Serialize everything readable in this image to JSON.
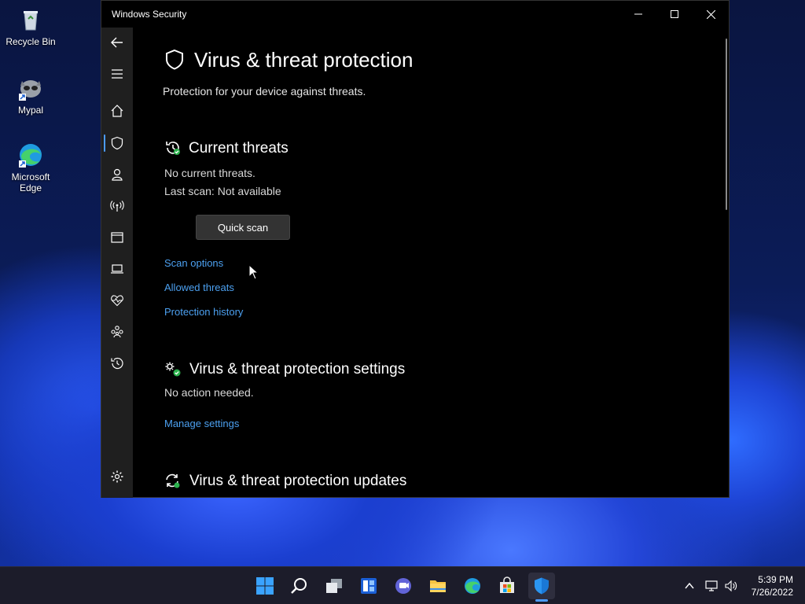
{
  "desktop": {
    "icons": [
      {
        "label": "Recycle Bin"
      },
      {
        "label": "Mypal"
      },
      {
        "label": "Microsoft Edge"
      }
    ]
  },
  "window": {
    "title": "Windows Security",
    "page_title": "Virus & threat protection",
    "page_subtitle": "Protection for your device against threats.",
    "current_threats": {
      "heading": "Current threats",
      "status": "No current threats.",
      "last_scan": "Last scan: Not available",
      "quick_scan_label": "Quick scan",
      "links": [
        "Scan options",
        "Allowed threats",
        "Protection history"
      ]
    },
    "settings": {
      "heading": "Virus & threat protection settings",
      "status": "No action needed.",
      "link": "Manage settings"
    },
    "updates": {
      "heading": "Virus & threat protection updates"
    }
  },
  "taskbar": {
    "time": "5:39 PM",
    "date": "7/26/2022"
  },
  "colors": {
    "accent": "#4ca0f0",
    "indicator": "#4c9bff",
    "window_bg": "#000000",
    "sidebar_bg": "#1f1f1f",
    "button_bg": "#333333"
  }
}
